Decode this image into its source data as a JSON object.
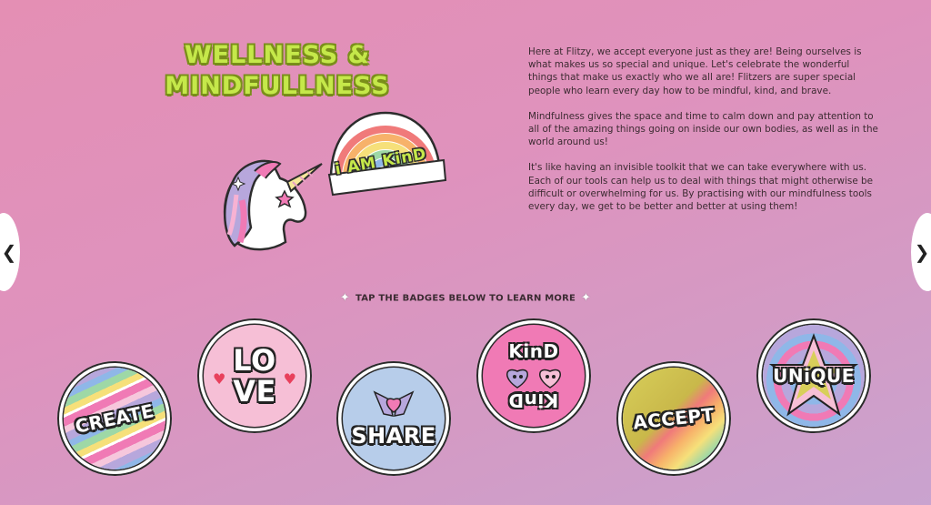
{
  "title": {
    "line1": "WELLNESS &",
    "line2": "MINDFULLNESS"
  },
  "paragraphs": [
    "Here at Flitzy, we accept everyone just as they are! Being ourselves is what makes us so special and unique. Let's celebrate the wonderful things that make us exactly who we all are! Flitzers are super special people who learn every day how to be mindful, kind, and brave.",
    "Mindfulness gives the space and time to calm down and pay attention to all of the amazing things going on inside our own bodies, as well as in the world around us!",
    "It's like having an invisible toolkit that we can take everywhere with us. Each of our tools can help us to deal with things that might otherwise be difficult or overwhelming for us. By practising with our mindfulness tools every day, we get to be better and better at using them!"
  ],
  "sticker_text": "i AM KinD",
  "tap_instruction": "TAP THE BADGES BELOW TO LEARN MORE",
  "nav": {
    "prev": "❮",
    "next": "❯"
  },
  "badges": [
    {
      "label": "CREATE"
    },
    {
      "label": "LO",
      "label2": "VE"
    },
    {
      "label": "SHARE"
    },
    {
      "label": "KinD",
      "label2": "KinD"
    },
    {
      "label": "ACCEPT"
    },
    {
      "label": "UNiQUE"
    }
  ],
  "colors": {
    "title": "#c5e84a",
    "title_outline": "#7a8f1a",
    "text": "#3d2b32"
  }
}
